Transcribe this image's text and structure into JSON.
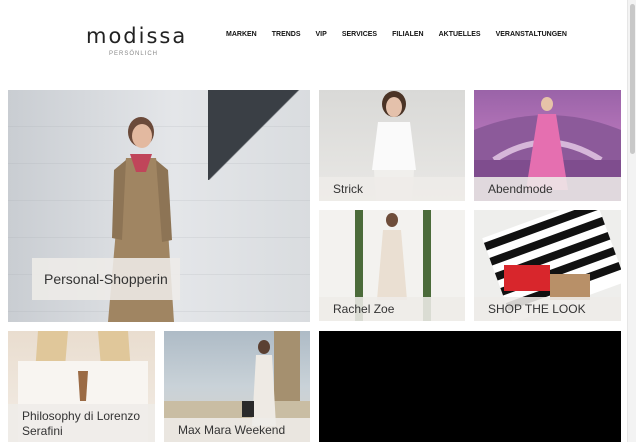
{
  "brand": {
    "name": "modissa",
    "tagline": "PERSÖNLICH"
  },
  "nav": [
    "MARKEN",
    "TRENDS",
    "VIP",
    "SERVICES",
    "FILIALEN",
    "AKTUELLES",
    "VERANSTALTUNGEN"
  ],
  "tiles": {
    "personal_shopperin": "Personal-Shopperin",
    "strick": "Strick",
    "abendmode": "Abendmode",
    "rachel_zoe": "Rachel Zoe",
    "shop_the_look": "SHOP THE LOOK",
    "philosophy": "Philosophy di Lorenzo Serafini",
    "max_mara": "Max Mara Weekend"
  }
}
